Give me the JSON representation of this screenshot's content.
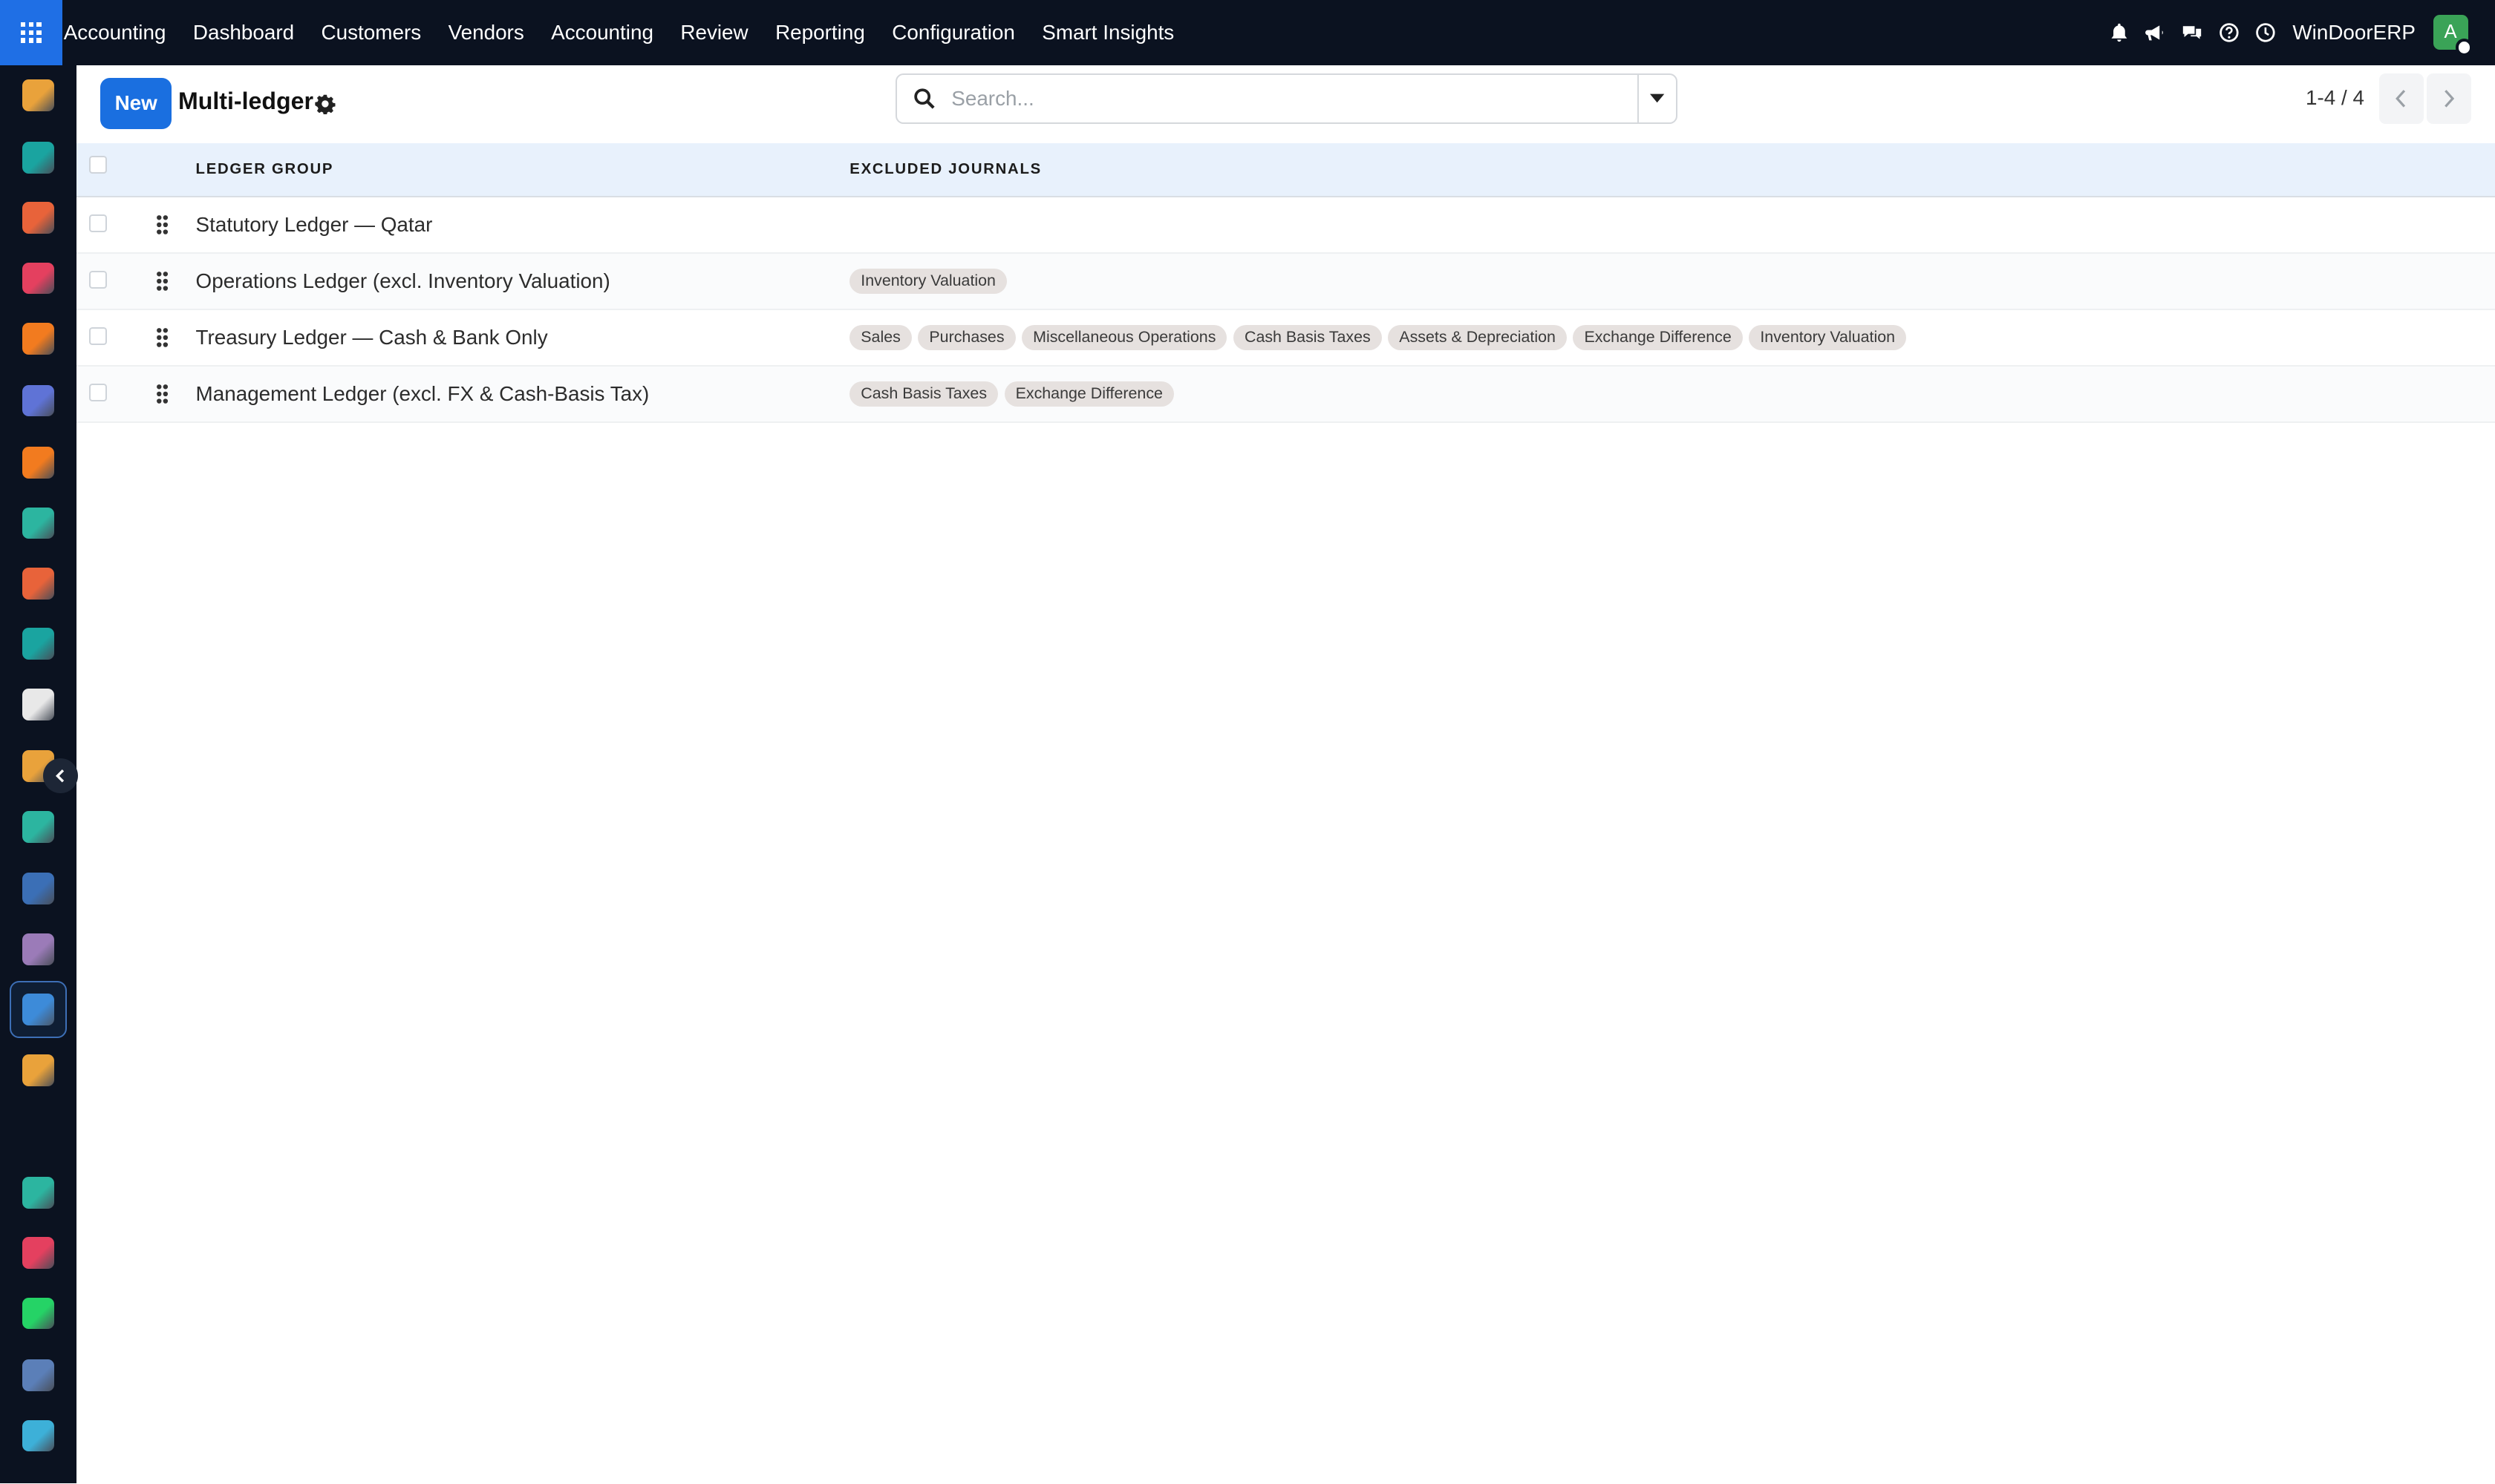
{
  "topbar": {
    "app_name": "Accounting",
    "menu": [
      "Dashboard",
      "Customers",
      "Vendors",
      "Accounting",
      "Review",
      "Reporting",
      "Configuration",
      "Smart Insights"
    ],
    "company": "WinDoorERP",
    "avatar_initial": "A",
    "icons": [
      "bell-icon",
      "megaphone-icon",
      "chat-icon",
      "help-icon",
      "clock-icon"
    ]
  },
  "sidebar": {
    "apps": [
      {
        "name": "app-discuss",
        "color": "#e9a23b"
      },
      {
        "name": "app-contacts",
        "color": "#1aa4a0"
      },
      {
        "name": "app-reporting",
        "color": "#e8633a"
      },
      {
        "name": "app-dashboard",
        "color": "#e4405f"
      },
      {
        "name": "app-crm",
        "color": "#f27b1f"
      },
      {
        "name": "app-mail",
        "color": "#5f73d6"
      },
      {
        "name": "app-live-chat",
        "color": "#f27b1f"
      },
      {
        "name": "app-sign",
        "color": "#2cb5a0"
      },
      {
        "name": "app-spreadsheet",
        "color": "#e8633a"
      },
      {
        "name": "app-employees",
        "color": "#1aa4a0"
      },
      {
        "name": "app-inventory",
        "color": "#e8e8e8"
      },
      {
        "name": "app-planning",
        "color": "#e9a23b"
      },
      {
        "name": "app-todo",
        "color": "#2cb5a0"
      },
      {
        "name": "app-knowledge",
        "color": "#3b6fb6"
      },
      {
        "name": "app-products",
        "color": "#9b7bb8"
      },
      {
        "name": "app-accounting",
        "color": "#3d8bd9"
      },
      {
        "name": "app-team",
        "color": "#e9a23b"
      },
      {
        "name": "app-calendar",
        "color": "#e9a23b"
      },
      {
        "name": "app-notes",
        "color": "#2cb5a0"
      },
      {
        "name": "app-dashboards",
        "color": "#e4405f"
      },
      {
        "name": "app-whatsapp",
        "color": "#25d366"
      },
      {
        "name": "app-timesheet",
        "color": "#5b7fb8"
      },
      {
        "name": "app-website",
        "color": "#3db0d8"
      }
    ]
  },
  "control": {
    "new_label": "New",
    "title": "Multi-ledger",
    "search_placeholder": "Search...",
    "pager": "1-4 / 4"
  },
  "table": {
    "columns": [
      "LEDGER GROUP",
      "EXCLUDED JOURNALS"
    ],
    "rows": [
      {
        "name": "Statutory Ledger — Qatar",
        "tags": []
      },
      {
        "name": "Operations Ledger (excl. Inventory Valuation)",
        "tags": [
          "Inventory Valuation"
        ]
      },
      {
        "name": "Treasury Ledger — Cash & Bank Only",
        "tags": [
          "Sales",
          "Purchases",
          "Miscellaneous Operations",
          "Cash Basis Taxes",
          "Assets & Depreciation",
          "Exchange Difference",
          "Inventory Valuation"
        ]
      },
      {
        "name": "Management Ledger (excl. FX & Cash-Basis Tax)",
        "tags": [
          "Cash Basis Taxes",
          "Exchange Difference"
        ]
      }
    ]
  }
}
